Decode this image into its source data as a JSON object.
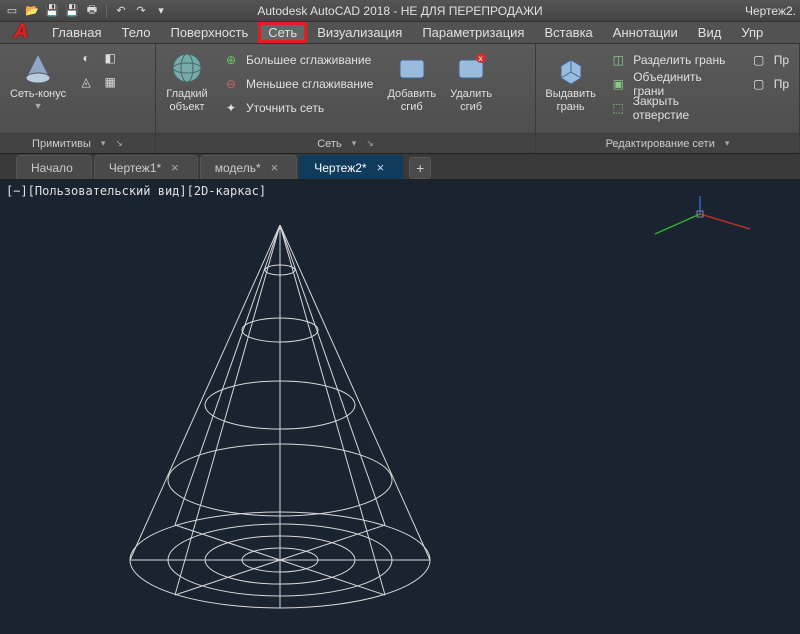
{
  "title": {
    "app": "Autodesk AutoCAD 2018 - НЕ ДЛЯ ПЕРЕПРОДАЖИ",
    "doc": "Чертеж2."
  },
  "menu": {
    "home": "Главная",
    "solid": "Тело",
    "surface": "Поверхность",
    "mesh": "Сеть",
    "visualize": "Визуализация",
    "parametric": "Параметризация",
    "insert": "Вставка",
    "annotate": "Аннотации",
    "view": "Вид",
    "manage": "Упр"
  },
  "ribbon": {
    "primitives": {
      "title": "Примитивы",
      "mesh_cone": "Сеть-конус"
    },
    "mesh": {
      "title": "Сеть",
      "smooth_object": "Гладкий\nобъект",
      "more_smooth": "Большее сглаживание",
      "less_smooth": "Меньшее сглаживание",
      "refine": "Уточнить сеть",
      "add_crease": "Добавить\nсгиб",
      "remove_crease": "Удалить\nсгиб"
    },
    "edit": {
      "title": "Редактирование сети",
      "extrude": "Выдавить\nгрань",
      "split_face": "Разделить грань",
      "merge_faces": "Объединить грани",
      "close_hole": "Закрыть отверстие",
      "pr1": "Пр",
      "pr2": "Пр"
    }
  },
  "tabs": {
    "start": "Начало",
    "d1": "Чертеж1*",
    "d2": "модель*",
    "d3": "Чертеж2*"
  },
  "viewport": {
    "label": "[−][Пользовательский вид][2D-каркас]"
  }
}
